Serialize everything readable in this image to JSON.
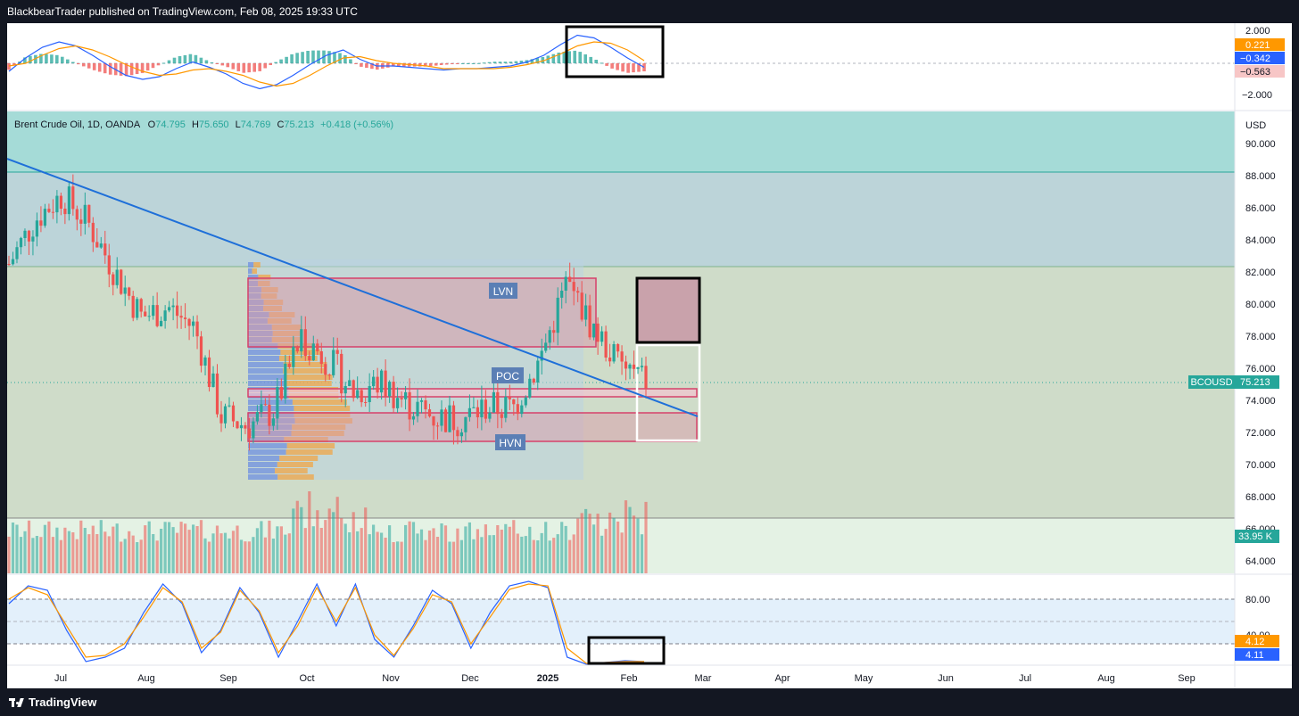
{
  "header": {
    "publish_line": "BlackbearTrader published on TradingView.com, Feb 08, 2025 19:33 UTC"
  },
  "footer": {
    "brand": "TradingView"
  },
  "legend": {
    "symbol": "Brent Crude Oil, 1D, OANDA",
    "o_label": "O",
    "o_value": "74.795",
    "h_label": "H",
    "h_value": "75.650",
    "l_label": "L",
    "l_value": "74.769",
    "c_label": "C",
    "c_value": "75.213",
    "change": "+0.418 (+0.56%)"
  },
  "colors": {
    "up": "#26a69a",
    "down": "#ef5350",
    "trendline": "#1e6fd9",
    "macd_line": "#2962ff",
    "signal_line": "#ff9800"
  },
  "annotations": {
    "lvn": "LVN",
    "poc": "POC",
    "hvn": "HVN"
  },
  "price_badges": {
    "symbol_tag": "BCOUSD",
    "last_price": "75.213",
    "volume": "33.95 K",
    "currency": "USD"
  },
  "macd_badges": {
    "hist": "0.221",
    "macd": "−0.342",
    "signal": "−0.563",
    "axis_top": "2.000",
    "axis_bottom": "−2.000"
  },
  "stoch_badges": {
    "k": "4.12",
    "d": "4.11",
    "axis_top": "80.00",
    "axis_mid": "40.00"
  },
  "chart_data": [
    {
      "type": "line",
      "panel": "macd",
      "series": [
        {
          "values": [
            -0.6,
            0.4,
            1.2,
            1.6,
            1.3,
            0.6,
            -0.2,
            -0.9,
            -1.2,
            -1.0,
            -0.4,
            0.1,
            -0.3,
            -0.8,
            -1.5,
            -1.9,
            -1.6,
            -0.9,
            -0.1,
            0.6,
            1.0,
            0.3,
            -0.2,
            -0.2,
            -0.3,
            -0.4,
            -0.5,
            -0.4,
            -0.4,
            -0.3,
            -0.2,
            0.1,
            0.6,
            1.4,
            2.1,
            1.9,
            1.2,
            0.4,
            -0.3
          ]
        },
        {
          "values": [
            -0.2,
            0.0,
            0.6,
            1.1,
            1.3,
            1.0,
            0.5,
            -0.1,
            -0.6,
            -0.9,
            -0.8,
            -0.5,
            -0.4,
            -0.6,
            -0.9,
            -1.4,
            -1.7,
            -1.5,
            -0.9,
            -0.2,
            0.4,
            0.5,
            0.2,
            0.0,
            -0.1,
            -0.2,
            -0.4,
            -0.4,
            -0.4,
            -0.4,
            -0.3,
            -0.1,
            0.2,
            0.7,
            1.3,
            1.6,
            1.5,
            1.0,
            0.2
          ]
        }
      ],
      "ylim": [
        -2.4,
        2.4
      ]
    },
    {
      "type": "line",
      "panel": "price",
      "x": [
        "Jun 15",
        "Jun 25",
        "Jul 5",
        "Jul 15",
        "Jul 25",
        "Aug 5",
        "Aug 15",
        "Aug 25",
        "Sep 5",
        "Sep 15",
        "Sep 25",
        "Oct 5",
        "Oct 15",
        "Oct 25",
        "Nov 5",
        "Nov 15",
        "Nov 25",
        "Dec 5",
        "Dec 15",
        "Dec 25",
        "Jan 5",
        "Jan 15",
        "Jan 25",
        "Feb 5",
        "Feb 8"
      ],
      "series": [
        {
          "values": [
            82.5,
            85.3,
            86.8,
            85.0,
            82.0,
            79.2,
            79.8,
            78.5,
            73.0,
            72.4,
            73.4,
            77.9,
            76.6,
            74.5,
            75.1,
            73.8,
            73.0,
            72.8,
            73.6,
            73.5,
            76.5,
            81.3,
            78.5,
            76.2,
            75.2
          ]
        }
      ],
      "ylim": [
        63,
        93.5
      ],
      "ticks": [
        "64.000",
        "66.000",
        "68.000",
        "70.000",
        "72.000",
        "74.000",
        "76.000",
        "78.000",
        "80.000",
        "82.000",
        "84.000",
        "86.000",
        "88.000",
        "90.000"
      ]
    },
    {
      "type": "line",
      "panel": "stochastic",
      "series": [
        {
          "values": [
            70,
            90,
            85,
            40,
            5,
            10,
            20,
            60,
            92,
            70,
            15,
            40,
            88,
            60,
            10,
            50,
            92,
            45,
            92,
            30,
            10,
            45,
            85,
            70,
            20,
            60,
            90,
            95,
            88,
            10,
            2,
            4,
            6,
            5
          ]
        },
        {
          "values": [
            75,
            88,
            80,
            45,
            10,
            12,
            25,
            55,
            88,
            72,
            20,
            38,
            85,
            62,
            15,
            45,
            88,
            50,
            88,
            35,
            12,
            42,
            80,
            72,
            25,
            55,
            86,
            92,
            90,
            20,
            3,
            4,
            5,
            5
          ]
        }
      ],
      "ylim": [
        0,
        100
      ]
    }
  ],
  "time_axis": [
    "Jul",
    "Aug",
    "Sep",
    "Oct",
    "Nov",
    "Dec",
    "2025",
    "Feb",
    "Mar",
    "Apr",
    "May",
    "Jun",
    "Jul",
    "Aug",
    "Sep"
  ]
}
